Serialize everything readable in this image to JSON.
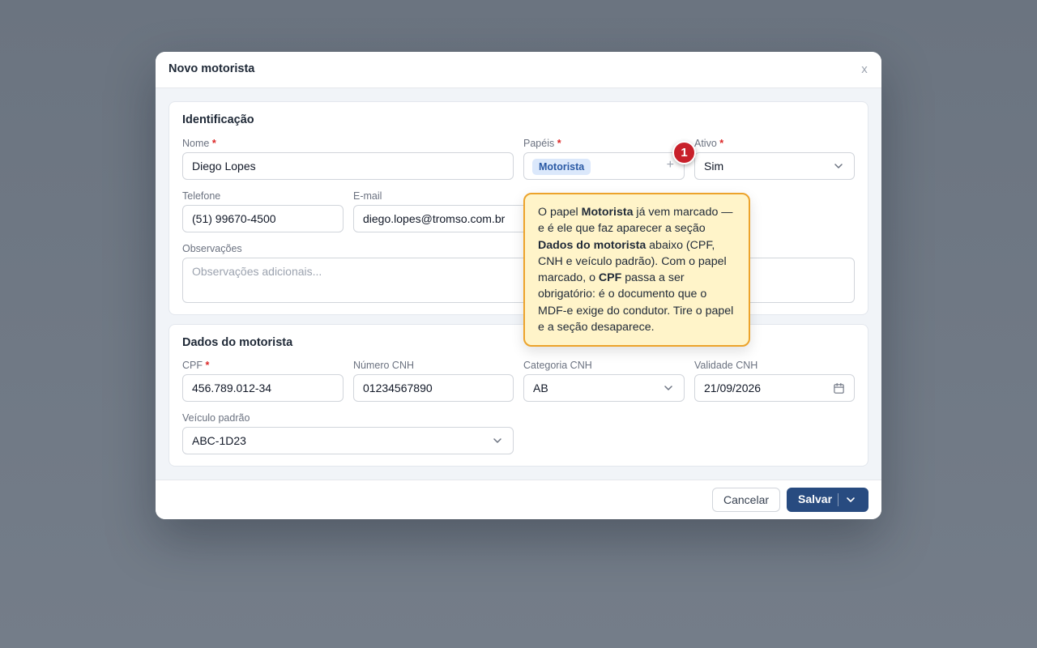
{
  "modal": {
    "title": "Novo motorista",
    "close_label": "x"
  },
  "identificacao": {
    "title": "Identificação",
    "nome": {
      "label": "Nome",
      "required": "*",
      "value": "Diego Lopes"
    },
    "papeis": {
      "label": "Papéis",
      "required": "*",
      "chip": "Motorista",
      "add": "+"
    },
    "ativo": {
      "label": "Ativo",
      "required": "*",
      "value": "Sim"
    },
    "telefone": {
      "label": "Telefone",
      "value": "(51) 99670-4500"
    },
    "email": {
      "label": "E-mail",
      "value": "diego.lopes@tromso.com.br"
    },
    "observacoes": {
      "label": "Observações",
      "placeholder": "Observações adicionais..."
    }
  },
  "dados_motorista": {
    "title": "Dados do motorista",
    "cpf": {
      "label": "CPF",
      "required": "*",
      "value": "456.789.012-34"
    },
    "numero_cnh": {
      "label": "Número CNH",
      "value": "01234567890"
    },
    "categoria_cnh": {
      "label": "Categoria CNH",
      "value": "AB"
    },
    "validade_cnh": {
      "label": "Validade CNH",
      "value": "21/09/2026"
    },
    "veiculo_padrao": {
      "label": "Veículo padrão",
      "value": "ABC-1D23"
    }
  },
  "tour": {
    "step": "1",
    "parts": [
      "O papel ",
      "Motorista",
      " já vem marcado — e é ele que faz aparecer a seção ",
      "Dados do motorista",
      " abaixo (CPF, CNH e veículo padrão). Com o papel marcado, o ",
      "CPF",
      " passa a ser obrigatório: é o documento que o MDF-e exige do condutor. Tire o papel e a seção desaparece."
    ]
  },
  "footer": {
    "cancel_label": "Cancelar",
    "save_label": "Salvar"
  },
  "colors": {
    "primary": "#284b80",
    "required": "#dc2626",
    "badge": "#c8202a",
    "tooltip_bg": "#fff4c9",
    "tooltip_border": "#eca32b"
  }
}
